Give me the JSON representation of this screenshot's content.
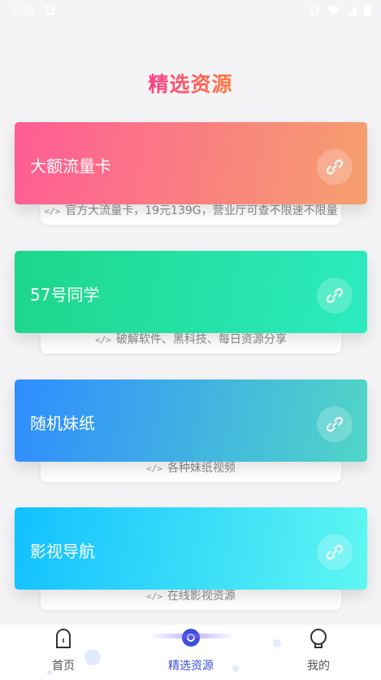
{
  "statusbar": {
    "time": "4:00"
  },
  "page_title": "精选资源",
  "cards": [
    {
      "title": "大额流量卡",
      "desc": "官方大流量卡，19元139G，营业厅可查不限速不限量",
      "gradient_start": "#ff5c95",
      "gradient_end": "#f5a06e"
    },
    {
      "title": "57号同学",
      "desc": "破解软件、黑科技、每日资源分享",
      "gradient_start": "#1ed68a",
      "gradient_end": "#2cebc0"
    },
    {
      "title": "随机妹纸",
      "desc": "各种妹纸视频",
      "gradient_start": "#2f8cff",
      "gradient_end": "#51d6c6"
    },
    {
      "title": "影视导航",
      "desc": "在线影视资源",
      "gradient_start": "#12c0ff",
      "gradient_end": "#5ef7f1"
    }
  ],
  "bottom_nav": [
    {
      "label": "首页",
      "icon": "home-icon",
      "active": false
    },
    {
      "label": "精选资源",
      "icon": "compass-icon",
      "active": true
    },
    {
      "label": "我的",
      "icon": "user-icon",
      "active": false
    }
  ],
  "colors": {
    "accent": "#3a50d9",
    "title_start": "#ff3d86",
    "title_end": "#ff7a3c"
  }
}
